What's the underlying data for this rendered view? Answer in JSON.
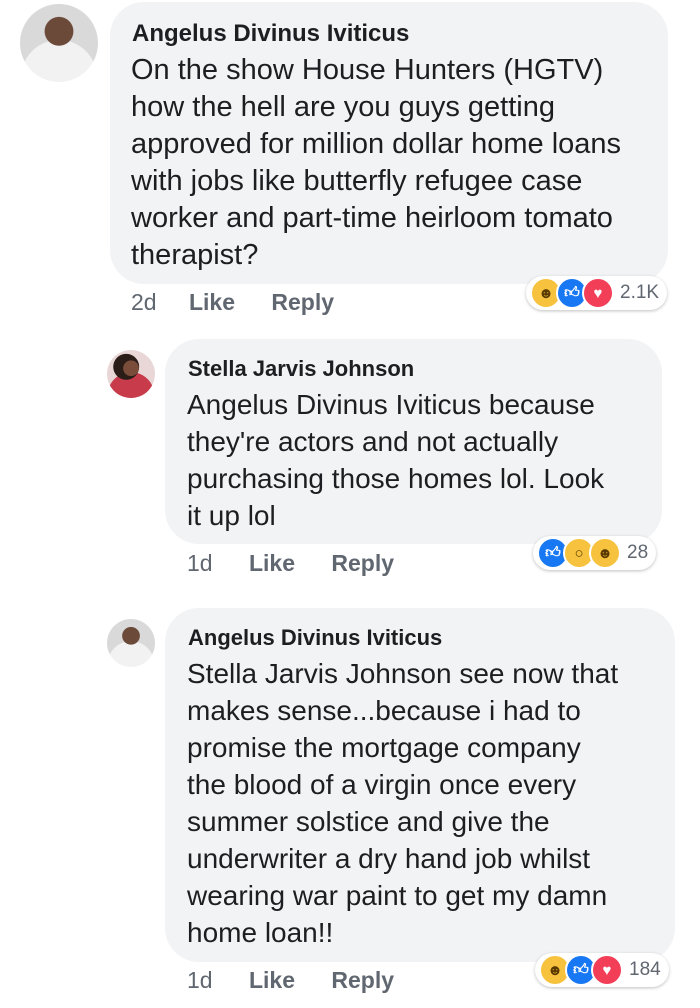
{
  "comments": [
    {
      "author": "Angelus Divinus Iviticus",
      "lines": [
        "On the show House Hunters (HGTV)",
        "how the hell are you guys getting",
        "approved for million dollar home loans",
        "with jobs like butterfly refugee case",
        "worker and part-time heirloom tomato",
        "therapist?"
      ],
      "time": "2d",
      "like_label": "Like",
      "reply_label": "Reply",
      "reactions": [
        "haha-icon",
        "like-icon",
        "love-icon"
      ],
      "reaction_count": "2.1K"
    },
    {
      "author": "Stella Jarvis Johnson",
      "lines": [
        "Angelus Divinus Iviticus because",
        "they're actors and not actually",
        "purchasing those homes lol. Look",
        "it up lol"
      ],
      "time": "1d",
      "like_label": "Like",
      "reply_label": "Reply",
      "reactions": [
        "like-icon",
        "wow-icon",
        "haha-icon"
      ],
      "reaction_count": "28"
    },
    {
      "author": "Angelus Divinus Iviticus",
      "lines": [
        "Stella Jarvis Johnson see now that",
        "makes sense...because i had to",
        "promise the mortgage company",
        "the blood of a virgin once every",
        "summer solstice and give the",
        "underwriter a dry hand job whilst",
        "wearing war paint to get my damn",
        "home loan!!"
      ],
      "time": "1d",
      "like_label": "Like",
      "reply_label": "Reply",
      "reactions": [
        "haha-icon",
        "like-icon",
        "love-icon"
      ],
      "reaction_count": "184"
    }
  ],
  "colors": {
    "bubble": "#f2f3f5",
    "meta_text": "#606770",
    "like_blue": "#1877f2",
    "love_red": "#f33e58",
    "haha_yellow": "#f7c33e"
  }
}
